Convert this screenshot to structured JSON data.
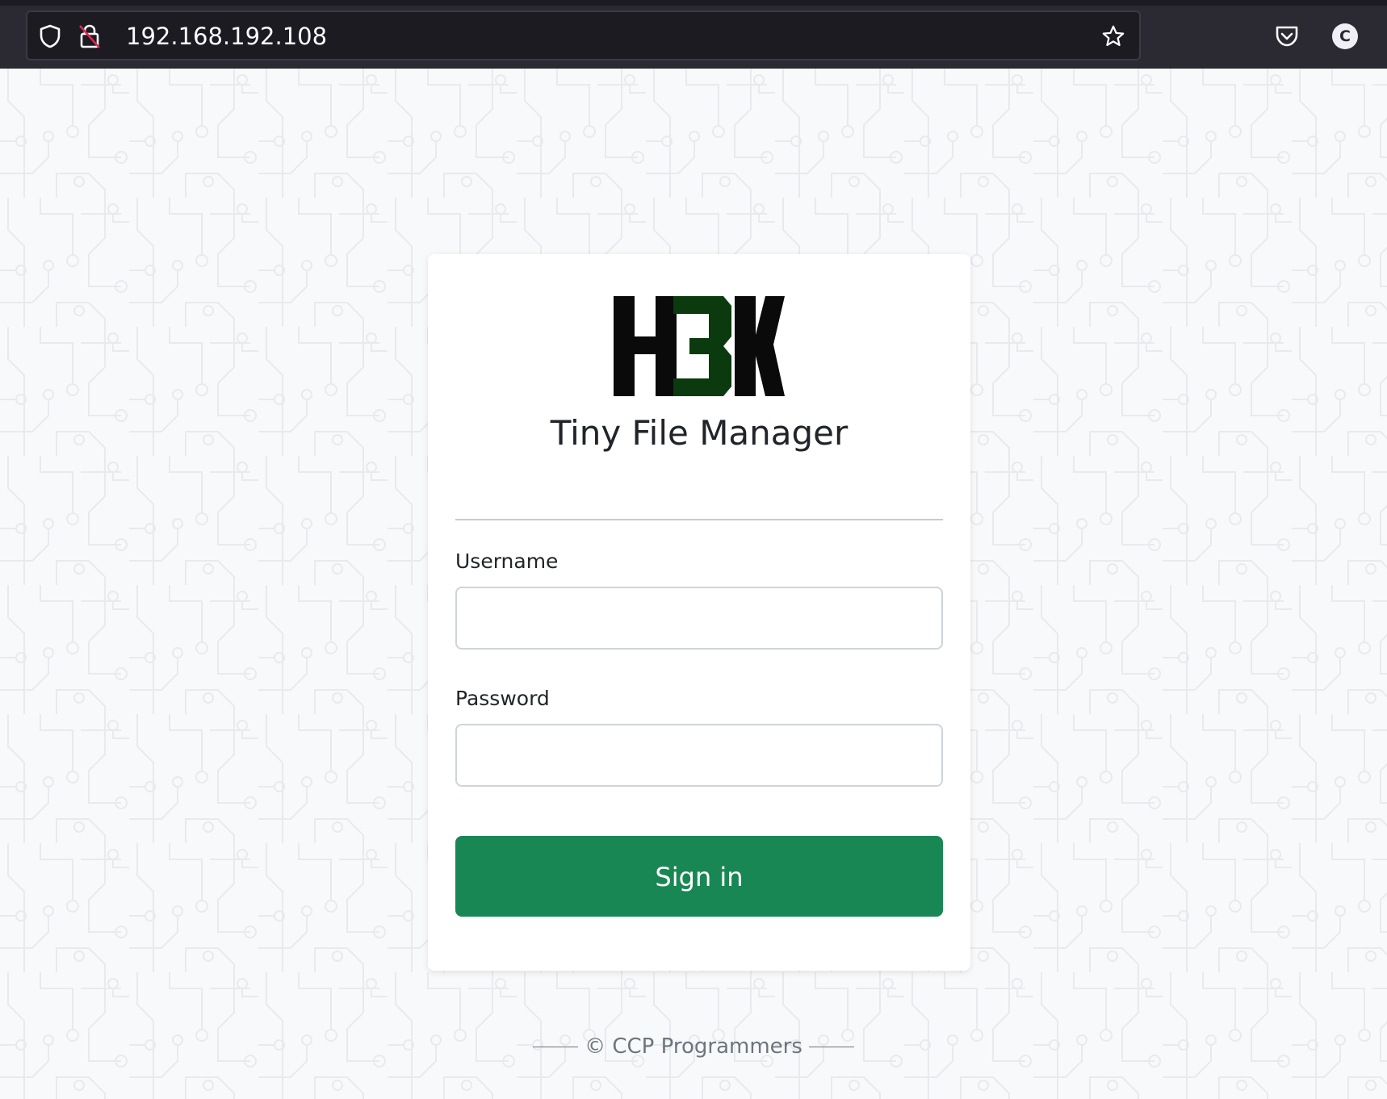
{
  "browser": {
    "url": "192.168.192.108",
    "profile_initial": "C",
    "icons": [
      "shield-icon",
      "lock-insecure-icon",
      "star-icon",
      "pocket-icon",
      "account-avatar"
    ]
  },
  "login": {
    "logo_text": "H3K",
    "title": "Tiny File Manager",
    "username_label": "Username",
    "username_value": "",
    "password_label": "Password",
    "password_value": "",
    "submit_label": "Sign in"
  },
  "footer": {
    "text": "© CCP Programmers"
  },
  "colors": {
    "toolbar_bg": "#2b2a33",
    "urlbar_bg": "#1c1b22",
    "page_bg": "#f8f9fa",
    "button_green": "#198754",
    "logo_green": "#0b3a0f"
  }
}
